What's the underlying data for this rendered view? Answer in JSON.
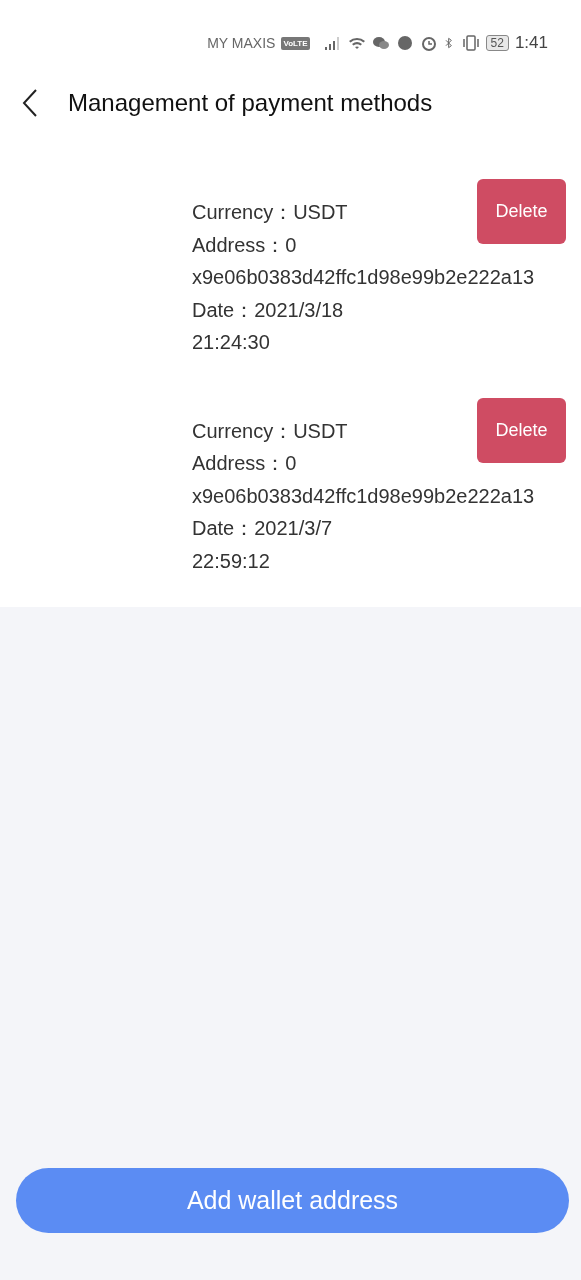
{
  "status_bar": {
    "carrier": "MY MAXIS",
    "network_badge": "VoLTE",
    "battery": "52",
    "time": "1:41"
  },
  "header": {
    "title": "Management of payment methods"
  },
  "wallets": [
    {
      "lines": [
        "Currency：USDT",
        "Address：0",
        "x9e06b0383d42ffc1d98e99b2e222a13",
        "Date：2021/3/18",
        "21:24:30"
      ],
      "action": "Delete"
    },
    {
      "lines": [
        "Currency：USDT",
        "Address：0",
        "x9e06b0383d42ffc1d98e99b2e222a13",
        "Date：2021/3/7",
        "22:59:12"
      ],
      "action": "Delete"
    }
  ],
  "add_button": "Add wallet address"
}
